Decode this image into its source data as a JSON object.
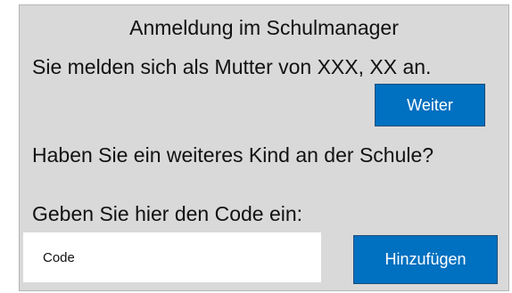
{
  "dialog": {
    "title": "Anmeldung im Schulmanager",
    "login_info": "Sie melden sich als Mutter von XXX, XX an.",
    "continue_label": "Weiter",
    "question": "Haben Sie ein weiteres Kind an der Schule?",
    "code_prompt": "Geben Sie hier den Code ein:",
    "code_input": {
      "value": "",
      "placeholder": "Code"
    },
    "add_label": "Hinzufügen"
  },
  "colors": {
    "panel_background": "#d9d9d9",
    "button_background": "#0070c0",
    "button_text": "#ffffff",
    "input_background": "#ffffff"
  }
}
